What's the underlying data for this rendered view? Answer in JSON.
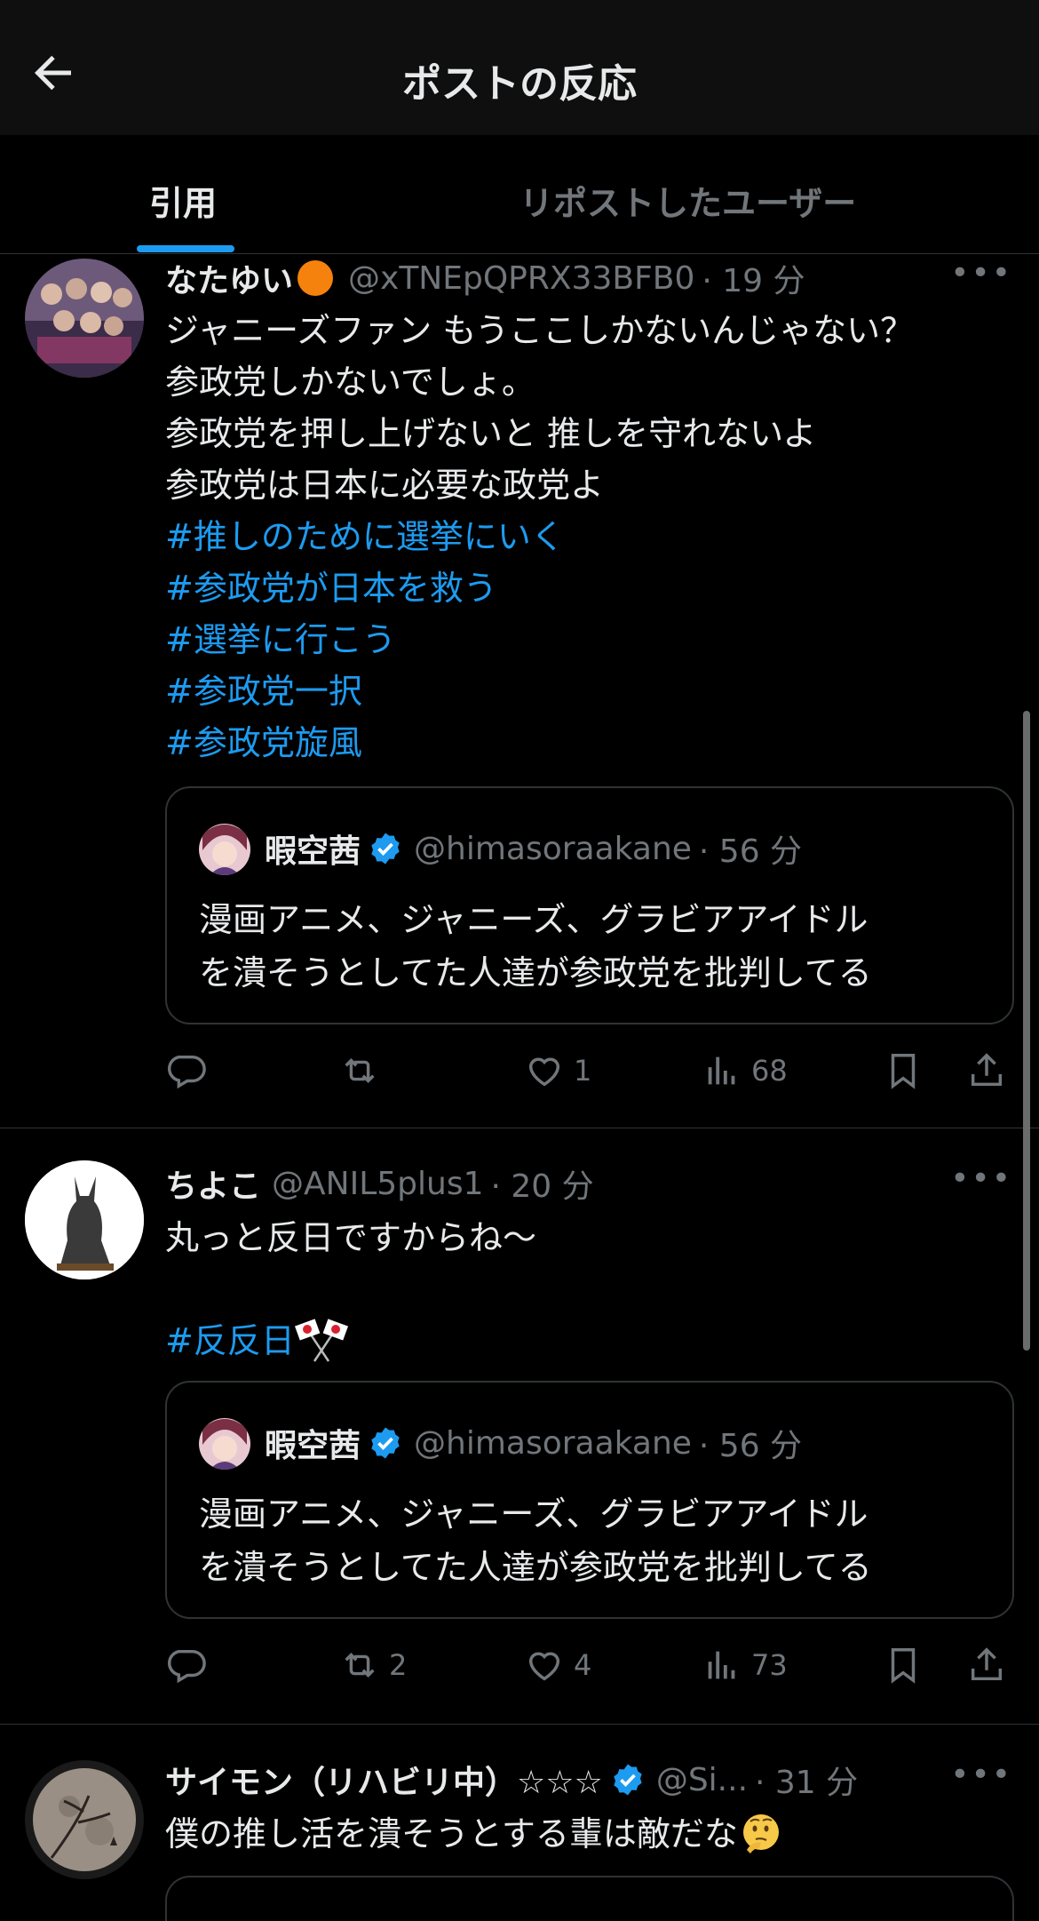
{
  "header": {
    "title": "ポストの反応",
    "back_icon": "arrow-left-icon"
  },
  "tabs": [
    {
      "label": "引用",
      "active": true
    },
    {
      "label": "リポストしたユーザー",
      "active": false
    }
  ],
  "posts": [
    {
      "name": "なたゆい",
      "handle": "@xTNEpQPRX33BFB0",
      "time": "· 19 分",
      "text_lines": [
        "ジャニーズファン もうここしかないんじゃない？",
        "参政党しかないでしょ。",
        "参政党を押し上げないと 推しを守れないよ",
        "参政党は日本に必要な政党よ"
      ],
      "hashtags": [
        "#推しのために選挙にいく",
        "#参政党が日本を救う",
        "#選挙に行こう",
        "#参政党一択",
        "#参政党旋風"
      ],
      "quote": {
        "name": "暇空茜",
        "handle": "@himasoraakane",
        "time": "· 56 分",
        "text_lines": [
          "漫画アニメ、ジャニーズ、グラビアアイドル",
          "を潰そうとしてた人達が参政党を批判してる"
        ]
      },
      "actions": {
        "replies": "",
        "reposts": "",
        "likes": "1",
        "views": "68"
      }
    },
    {
      "name": "ちよこ",
      "handle": "@ANIL5plus1",
      "time": "· 20 分",
      "text_lines": [
        "丸っと反日ですからね〜"
      ],
      "hashtags": [
        "#反反日"
      ],
      "quote": {
        "name": "暇空茜",
        "handle": "@himasoraakane",
        "time": "· 56 分",
        "text_lines": [
          "漫画アニメ、ジャニーズ、グラビアアイドル",
          "を潰そうとしてた人達が参政党を批判してる"
        ]
      },
      "actions": {
        "replies": "",
        "reposts": "2",
        "likes": "4",
        "views": "73"
      }
    },
    {
      "name": "サイモン（リハビリ中）☆☆☆",
      "handle": "@Si...",
      "time": "· 31 分",
      "text_lines": [
        "僕の推し活を潰そうとする輩は敵だな"
      ]
    }
  ],
  "colors": {
    "accent": "#1d9bf0",
    "muted": "#71767b",
    "text": "#e7e9ea",
    "border": "#2f3336",
    "header_bg": "#0f0f0f"
  }
}
